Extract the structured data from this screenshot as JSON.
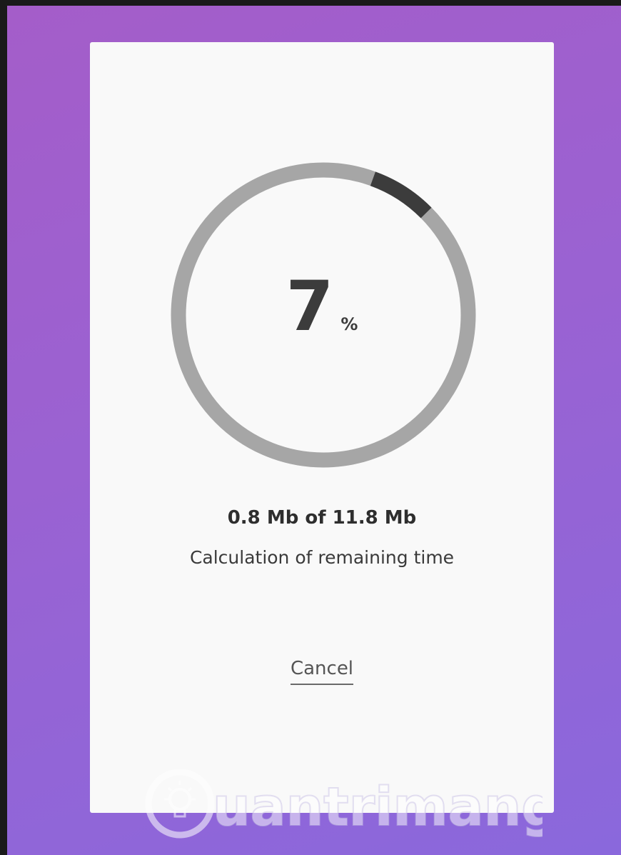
{
  "progress": {
    "percent_value": "7",
    "percent_unit": "%",
    "fraction": 0.07
  },
  "transfer": {
    "size_text": "0.8 Mb of 11.8 Mb",
    "status_text": "Calculation of remaining time"
  },
  "actions": {
    "cancel_label": "Cancel"
  },
  "watermark": {
    "text": "uantrimang",
    "icon": "lightbulb-icon"
  },
  "colors": {
    "background_start": "#a45dc9",
    "background_end": "#8a68dc",
    "card": "#f9f9f9",
    "ring_track": "#a6a6a6",
    "ring_progress": "#3c3c3c",
    "text": "#3c3c3c"
  }
}
